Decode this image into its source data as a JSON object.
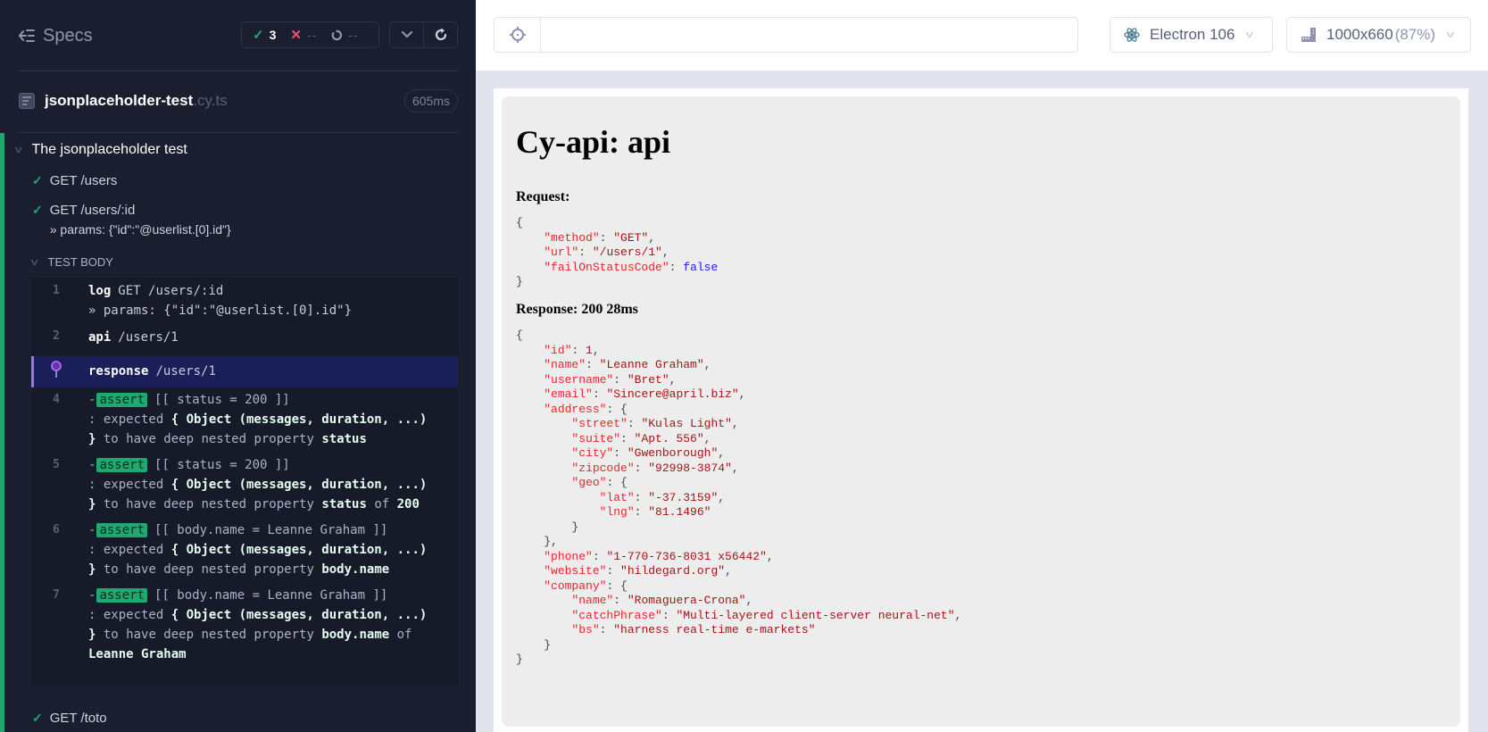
{
  "sidebar": {
    "specs_label": "Specs",
    "stats": {
      "passed": "3",
      "failed": "--",
      "pending": "--"
    },
    "spec": {
      "name": "jsonplaceholder-test",
      "ext": ".cy.ts",
      "duration": "605ms"
    },
    "suite_title": "The jsonplaceholder test",
    "tests": [
      {
        "title": "GET /users",
        "status": "passed"
      },
      {
        "title": "GET /users/:id",
        "params": "» params: {\"id\":\"@userlist.[0].id\"}",
        "status": "passed"
      },
      {
        "title": "GET /toto",
        "status": "passed"
      }
    ],
    "test_body_label": "TEST BODY",
    "commands": [
      {
        "num": "1",
        "name": "log",
        "message": "GET /users/:id",
        "message2": "» params: {\"id\":\"@userlist.[0].id\"}"
      },
      {
        "num": "2",
        "name": "api",
        "message": "/users/1"
      },
      {
        "num": "",
        "name": "response",
        "message": "/users/1",
        "active": true,
        "icon": "pin-icon"
      },
      {
        "num": "4",
        "tag": "assert",
        "expr": "[[ status = 200 ]]",
        "l2a": ": expected ",
        "l2b": "{ Object (messages, duration, ...)",
        "l3a": "}",
        "l3b": " to have deep nested property ",
        "l3c": "status",
        "l3d": "",
        "l3e": "",
        "l4": ""
      },
      {
        "num": "5",
        "tag": "assert",
        "expr": "[[ status = 200 ]]",
        "l2a": ": expected ",
        "l2b": "{ Object (messages, duration, ...)",
        "l3a": "}",
        "l3b": " to have deep nested property ",
        "l3c": "status",
        "l3d": " of ",
        "l3e": "200",
        "l4": ""
      },
      {
        "num": "6",
        "tag": "assert",
        "expr": "[[ body.name = Leanne Graham ]]",
        "l2a": ": expected ",
        "l2b": "{ Object (messages, duration, ...)",
        "l3a": "}",
        "l3b": " to have deep nested property ",
        "l3c": "body.name",
        "l3d": "",
        "l3e": "",
        "l4": ""
      },
      {
        "num": "7",
        "tag": "assert",
        "expr": "[[ body.name = Leanne Graham ]]",
        "l2a": ": expected ",
        "l2b": "{ Object (messages, duration, ...)",
        "l3a": "}",
        "l3b": " to have deep nested property ",
        "l3c": "body.name",
        "l3d": " of",
        "l3e": "",
        "l4": "Leanne Graham"
      }
    ]
  },
  "toolbar": {
    "url_value": "",
    "browser": "Electron 106",
    "viewport": "1000x660",
    "viewport_scale": "(87%)"
  },
  "preview": {
    "title": "Cy-api: api",
    "request_label": "Request:",
    "request": [
      {
        "indent": 0,
        "text": "{"
      },
      {
        "indent": 1,
        "key": "method",
        "str": "GET",
        "end": ","
      },
      {
        "indent": 1,
        "key": "url",
        "str": "/users/1",
        "end": ","
      },
      {
        "indent": 1,
        "key": "failOnStatusCode",
        "bool": "false",
        "end": ""
      },
      {
        "indent": 0,
        "text": "}"
      }
    ],
    "response_label": "Response: 200 28ms",
    "response": [
      {
        "indent": 0,
        "text": "{"
      },
      {
        "indent": 1,
        "key": "id",
        "num": "1",
        "end": ","
      },
      {
        "indent": 1,
        "key": "name",
        "str": "Leanne Graham",
        "end": ","
      },
      {
        "indent": 1,
        "key": "username",
        "str": "Bret",
        "end": ","
      },
      {
        "indent": 1,
        "key": "email",
        "str": "Sincere@april.biz",
        "end": ","
      },
      {
        "indent": 1,
        "key": "address",
        "open": "{"
      },
      {
        "indent": 2,
        "key": "street",
        "str": "Kulas Light",
        "end": ","
      },
      {
        "indent": 2,
        "key": "suite",
        "str": "Apt. 556",
        "end": ","
      },
      {
        "indent": 2,
        "key": "city",
        "str": "Gwenborough",
        "end": ","
      },
      {
        "indent": 2,
        "key": "zipcode",
        "str": "92998-3874",
        "end": ","
      },
      {
        "indent": 2,
        "key": "geo",
        "open": "{"
      },
      {
        "indent": 3,
        "key": "lat",
        "str": "-37.3159",
        "end": ","
      },
      {
        "indent": 3,
        "key": "lng",
        "str": "81.1496",
        "end": ""
      },
      {
        "indent": 2,
        "text": "}"
      },
      {
        "indent": 1,
        "text": "},"
      },
      {
        "indent": 1,
        "key": "phone",
        "str": "1-770-736-8031 x56442",
        "end": ","
      },
      {
        "indent": 1,
        "key": "website",
        "str": "hildegard.org",
        "end": ","
      },
      {
        "indent": 1,
        "key": "company",
        "open": "{"
      },
      {
        "indent": 2,
        "key": "name",
        "str": "Romaguera-Crona",
        "end": ","
      },
      {
        "indent": 2,
        "key": "catchPhrase",
        "str": "Multi-layered client-server neural-net",
        "end": ","
      },
      {
        "indent": 2,
        "key": "bs",
        "str": "harness real-time e-markets",
        "end": ""
      },
      {
        "indent": 1,
        "text": "}"
      },
      {
        "indent": 0,
        "text": "}"
      }
    ]
  },
  "colors": {
    "sidebar_bg": "#1b1e2e",
    "pass": "#1fa971",
    "fail": "#e45770",
    "active_cmd": "#1a1f5a",
    "pin": "#a371ea",
    "json_key": "#e8262d",
    "json_string": "#a31515",
    "json_bool": "#1a1aff"
  }
}
